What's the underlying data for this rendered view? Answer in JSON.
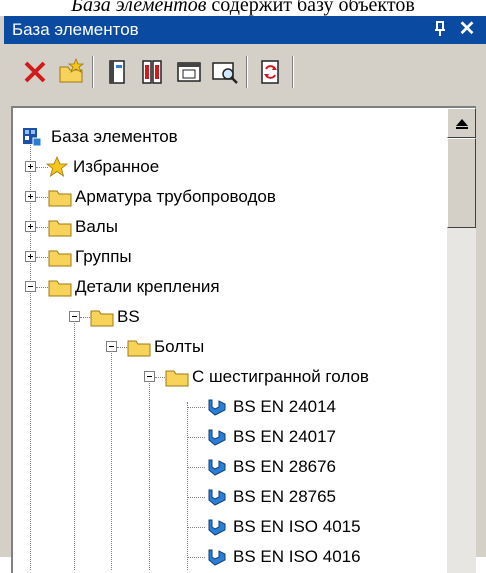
{
  "caption": {
    "italic_part": "База элементов",
    "rest": "содержит базу объектов"
  },
  "window": {
    "title": "База элементов",
    "pin_glyph": "ᅳ",
    "close_glyph": "✕"
  },
  "toolbar": {
    "buttons": [
      {
        "name": "delete-button",
        "icon": "red-x-icon"
      },
      {
        "name": "new-folder-button",
        "icon": "folder-star-icon"
      },
      {
        "name": "properties-button",
        "icon": "book-icon"
      },
      {
        "name": "parameters-button",
        "icon": "books-icon"
      },
      {
        "name": "preview-button",
        "icon": "window-icon"
      },
      {
        "name": "find-button",
        "icon": "magnifier-icon"
      },
      {
        "name": "refresh-button",
        "icon": "refresh-icon"
      }
    ]
  },
  "tree": {
    "root": "База элементов",
    "favorites": "Избранное",
    "pipe_fittings": "Арматура трубопроводов",
    "shafts": "Валы",
    "groups": "Группы",
    "fasteners": "Детали крепления",
    "bs": "BS",
    "bolts": "Болты",
    "hex_head": "С шестигранной голов",
    "items": [
      "BS EN 24014",
      "BS EN 24017",
      "BS EN 28676",
      "BS EN 28765",
      "BS EN ISO 4015",
      "BS EN ISO 4016"
    ]
  },
  "colors": {
    "titlebar": "#0a4aa0",
    "panel": "#d4d0c8",
    "folder": "#f7d35a",
    "part_icon": "#2a7fd4",
    "star": "#f5c518"
  }
}
